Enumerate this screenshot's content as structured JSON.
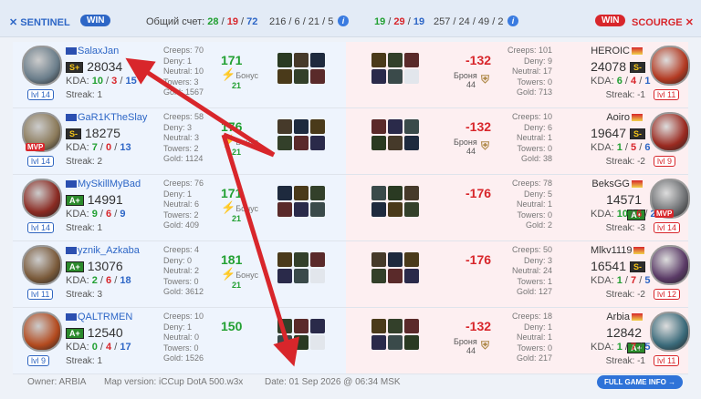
{
  "header": {
    "sentinel_label": "SENTINEL",
    "sentinel_win": "WIN",
    "total_score_label": "Общий счет:",
    "score_s": "28",
    "score_m": "19",
    "score_e": "72",
    "left_kda_prefix": "216 / 6 / 21 / 5",
    "right_score_s": "19",
    "right_score_m": "29",
    "right_score_e": "19",
    "right_kda": "257 / 24 / 49 / 2",
    "scourge_win": "WIN",
    "scourge_label": "SCOURGE"
  },
  "left_players": [
    {
      "name": "SalaxJan",
      "rank": "S+",
      "rating": "28034",
      "k": "10",
      "d": "3",
      "a": "15",
      "level": "lvl 14",
      "streak": "Streak: 1",
      "gold": "171",
      "creeps": "Creeps: 70",
      "deny": "Deny: 1",
      "neutral": "Neutral: 10",
      "towers": "Towers: 3",
      "gold_total": "Gold: 1567",
      "bonus_label": "Бонус",
      "bonus_value": "21",
      "mvp": ""
    },
    {
      "name": "GaR1KTheSlay",
      "rank": "S-",
      "rating": "18275",
      "k": "7",
      "d": "0",
      "a": "13",
      "level": "lvl 14",
      "streak": "Streak: 2",
      "gold": "176",
      "creeps": "Creeps: 58",
      "deny": "Deny: 3",
      "neutral": "Neutral: 3",
      "towers": "Towers: 2",
      "gold_total": "Gold: 1124",
      "bonus_label": "Бонус",
      "bonus_value": "21",
      "mvp": "MVP"
    },
    {
      "name": "MySkillMyBad",
      "rank": "A+",
      "rating": "14991",
      "k": "9",
      "d": "6",
      "a": "9",
      "level": "lvl 14",
      "streak": "Streak: 1",
      "gold": "171",
      "creeps": "Creeps: 76",
      "deny": "Deny: 1",
      "neutral": "Neutral: 6",
      "towers": "Towers: 2",
      "gold_total": "Gold: 409",
      "bonus_label": "Бонус",
      "bonus_value": "21",
      "mvp": ""
    },
    {
      "name": "yznik_Azkaba",
      "rank": "A+",
      "rating": "13076",
      "k": "2",
      "d": "6",
      "a": "18",
      "level": "lvl 11",
      "streak": "Streak: 3",
      "gold": "181",
      "creeps": "Creeps: 4",
      "deny": "Deny: 0",
      "neutral": "Neutral: 2",
      "towers": "Towers: 0",
      "gold_total": "Gold: 3612",
      "bonus_label": "Бонус",
      "bonus_value": "21",
      "mvp": ""
    },
    {
      "name": "QALTRMEN",
      "rank": "A+",
      "rating": "12540",
      "k": "0",
      "d": "4",
      "a": "17",
      "level": "lvl 9",
      "streak": "Streak: 1",
      "gold": "150",
      "creeps": "Creeps: 10",
      "deny": "Deny: 1",
      "neutral": "Neutral: 0",
      "towers": "Towers: 0",
      "gold_total": "Gold: 1526",
      "bonus_label": "",
      "bonus_value": "",
      "mvp": ""
    }
  ],
  "right_players": [
    {
      "name": "HEROIC",
      "rank": "S-",
      "rating": "24078",
      "k": "6",
      "d": "4",
      "a": "1",
      "level": "lvl 11",
      "streak": "Streak: -1",
      "loss": "-132",
      "creeps": "Creeps: 101",
      "deny": "Deny: 9",
      "neutral": "Neutral: 17",
      "towers": "Towers: 0",
      "gold_total": "Gold: 713",
      "armor_label": "Броня",
      "armor_value": "44",
      "mvp": ""
    },
    {
      "name": "Aoiro",
      "rank": "S-",
      "rating": "19647",
      "k": "1",
      "d": "5",
      "a": "6",
      "level": "lvl 9",
      "streak": "Streak: -2",
      "loss": "-132",
      "creeps": "Creeps: 10",
      "deny": "Deny: 6",
      "neutral": "Neutral: 1",
      "towers": "Towers: 0",
      "gold_total": "Gold: 38",
      "armor_label": "Броня",
      "armor_value": "44",
      "mvp": ""
    },
    {
      "name": "BeksGG",
      "rank": "A+",
      "rating": "14571",
      "k": "10",
      "d": "6",
      "a": "2",
      "level": "lvl 14",
      "streak": "Streak: -3",
      "loss": "-176",
      "creeps": "Creeps: 78",
      "deny": "Deny: 5",
      "neutral": "Neutral: 1",
      "towers": "Towers: 0",
      "gold_total": "Gold: 2",
      "armor_label": "",
      "armor_value": "",
      "mvp": "MVP"
    },
    {
      "name": "Mlkv1119",
      "rank": "S-",
      "rating": "16541",
      "k": "1",
      "d": "7",
      "a": "5",
      "level": "lvl 12",
      "streak": "Streak: -2",
      "loss": "-176",
      "creeps": "Creeps: 50",
      "deny": "Deny: 3",
      "neutral": "Neutral: 24",
      "towers": "Towers: 1",
      "gold_total": "Gold: 127",
      "armor_label": "",
      "armor_value": "",
      "mvp": ""
    },
    {
      "name": "Arbia",
      "rank": "A+",
      "rating": "12842",
      "k": "1",
      "d": "7",
      "a": "5",
      "level": "lvl 11",
      "streak": "Streak: -1",
      "loss": "-132",
      "creeps": "Creeps: 18",
      "deny": "Deny: 1",
      "neutral": "Neutral: 1",
      "towers": "Towers: 0",
      "gold_total": "Gold: 217",
      "armor_label": "Броня",
      "armor_value": "44",
      "mvp": ""
    }
  ],
  "footer": {
    "owner": "Owner: ARBIA",
    "map": "Map version: iCCup DotA 500.w3x",
    "date": "Date: 01 Sep 2026 @ 06:34 MSK",
    "full_info": "FULL GAME INFO →"
  },
  "colors": {
    "sentinel": "#2d66c6",
    "scourge": "#d8262b",
    "gain": "#22a032",
    "arrow": "#d8262b"
  }
}
